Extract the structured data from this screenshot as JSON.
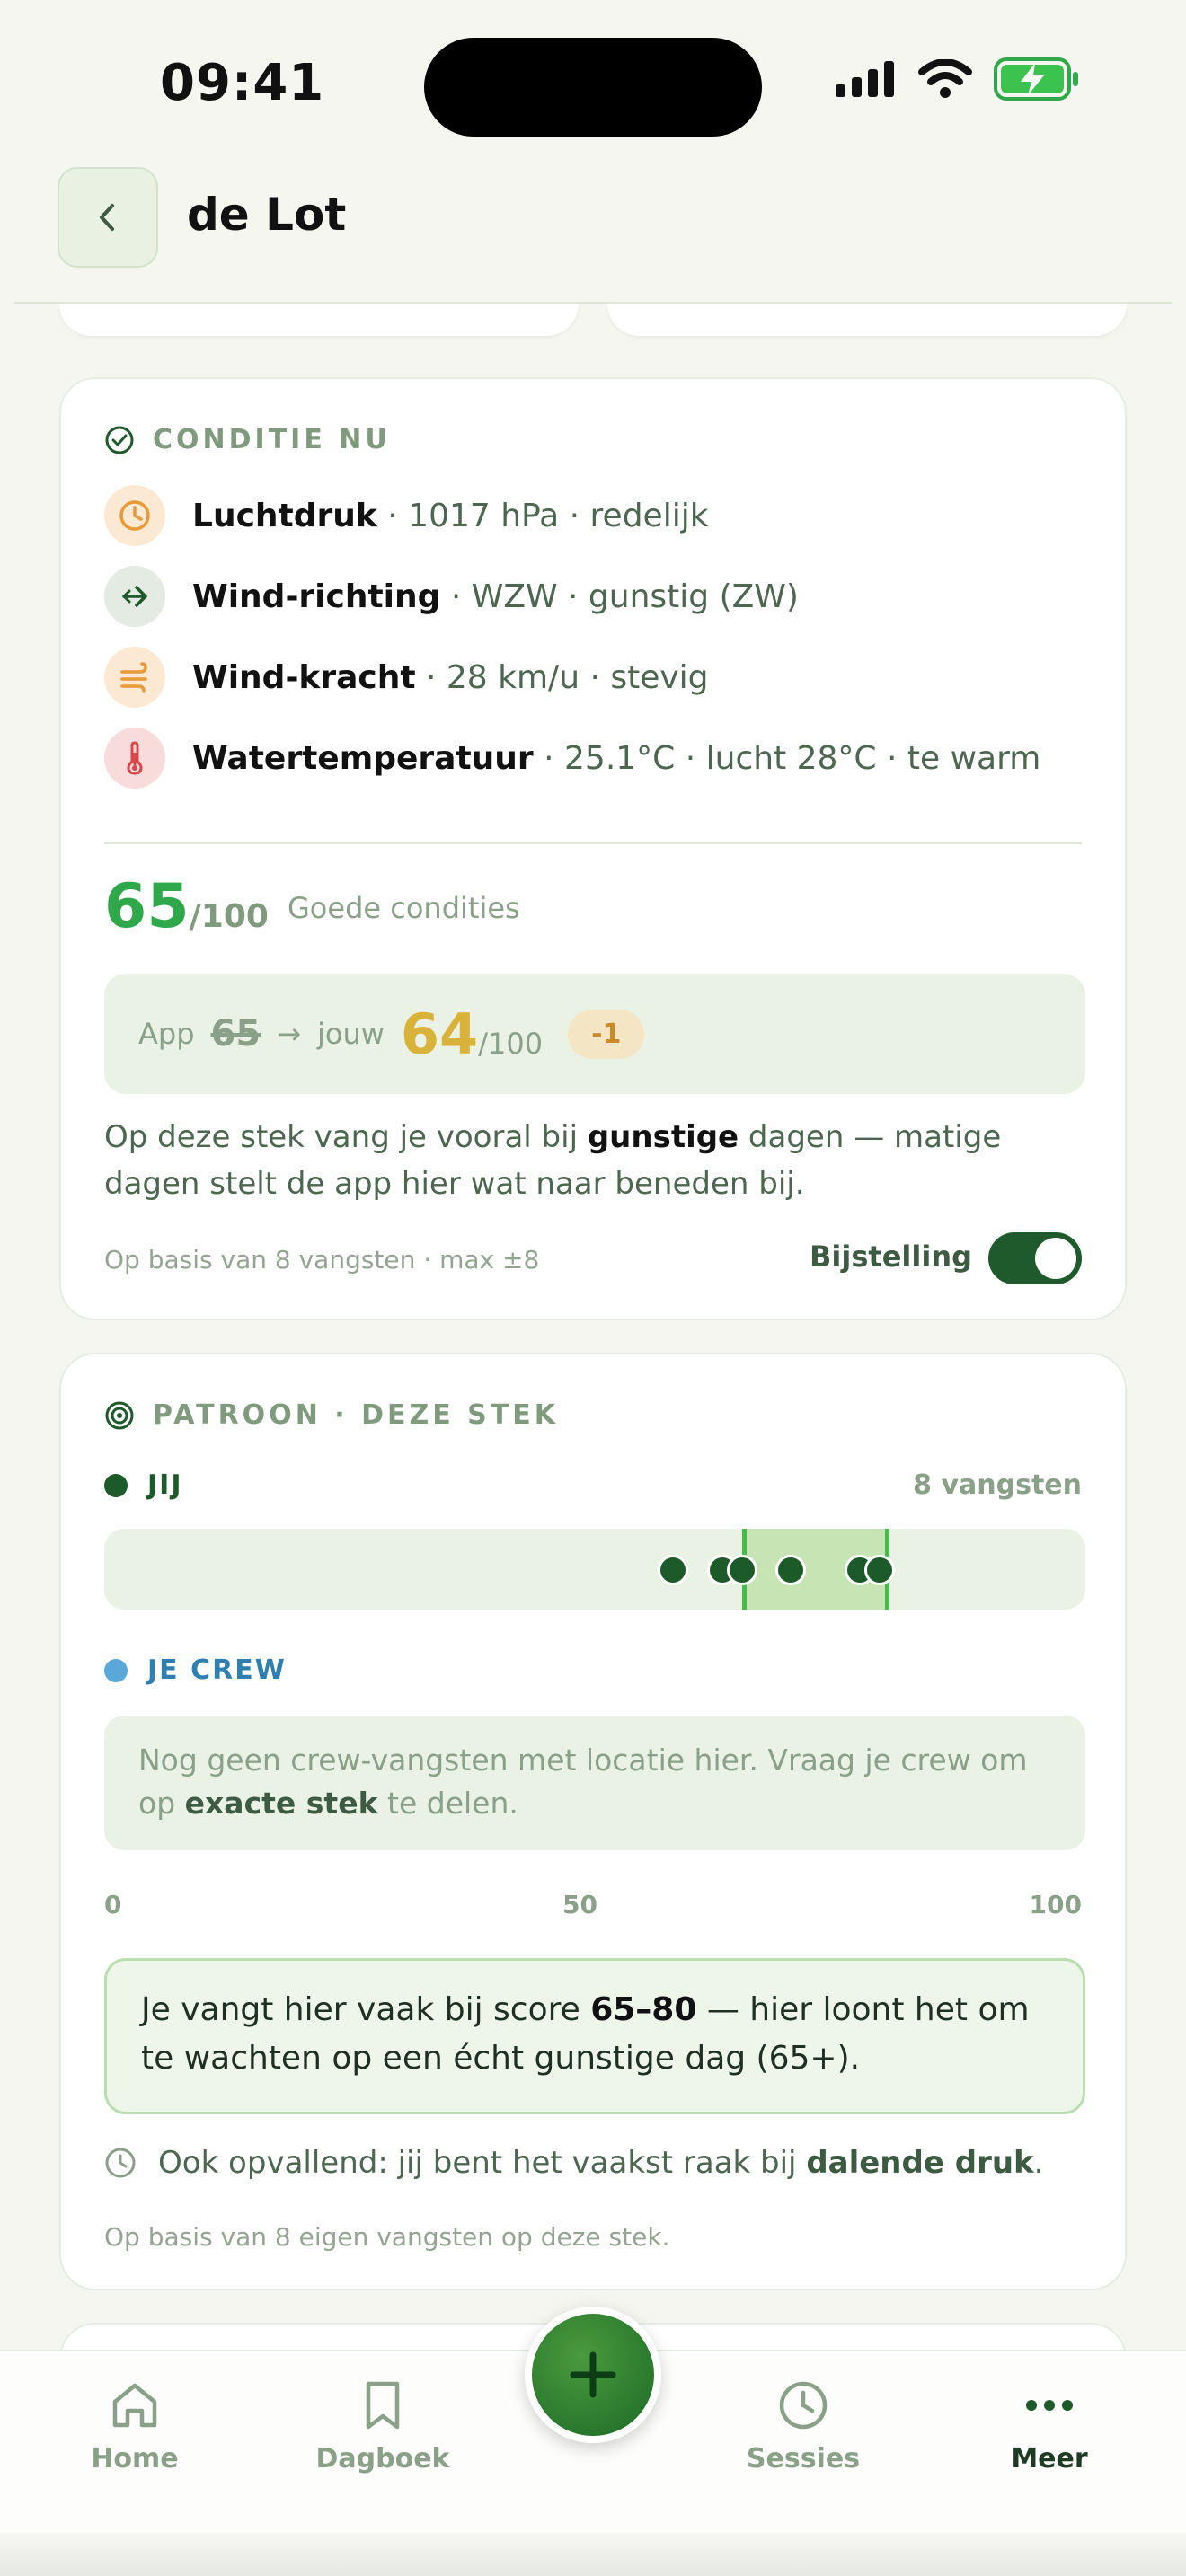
{
  "status": {
    "time": "09:41"
  },
  "header": {
    "title": "de Lot"
  },
  "condition": {
    "section_title": "CONDITIE NU",
    "rows": [
      {
        "icon": "clock-icon",
        "label": "Luchtdruk",
        "detail": " · 1017 hPa · redelijk",
        "color": "#e8993a",
        "bg": "#fbe9d4"
      },
      {
        "icon": "arrow-right-icon",
        "label": "Wind-richting",
        "detail": " · WZW · gunstig (ZW)",
        "color": "#1f5a2c",
        "bg": "#e4ebe2"
      },
      {
        "icon": "wind-icon",
        "label": "Wind-kracht",
        "detail": " · 28 km/u · stevig",
        "color": "#e8993a",
        "bg": "#fbe9d4"
      },
      {
        "icon": "thermometer-icon",
        "label": "Watertemperatuur",
        "detail": " · 25.1°C · lucht 28°C · te warm",
        "color": "#d9474a",
        "bg": "#f8dcdc"
      }
    ],
    "score": "65",
    "score_max": "/100",
    "score_label": "Goede condities",
    "adjust": {
      "app_label": "App",
      "app_score": "65",
      "arrow": "→",
      "you_label": "jouw",
      "you_score": "64",
      "you_max": "/100",
      "delta": "-1"
    },
    "explanation_pre": "Op deze stek vang je vooral bij ",
    "explanation_bold": "gunstige",
    "explanation_post": " dagen — matige dagen stelt de app hier wat naar beneden bij.",
    "footnote": "Op basis van 8 vangsten · max ±8",
    "toggle_label": "Bijstelling",
    "toggle_on": true
  },
  "pattern": {
    "section_title": "PATROON · DEZE STEK",
    "you_label": "JIJ",
    "you_count": "8 vangsten",
    "you_color": "#1c5a2a",
    "catch_scores": [
      58,
      63,
      65,
      70,
      77,
      79
    ],
    "band": [
      65,
      80
    ],
    "crew_label": "JE CREW",
    "crew_color": "#5aa7d9",
    "crew_empty_pre": "Nog geen crew-vangsten met locatie hier. Vraag je crew om op ",
    "crew_empty_bold": "exacte stek",
    "crew_empty_post": " te delen.",
    "axis": [
      "0",
      "50",
      "100"
    ],
    "insight_pre": "Je vangt hier vaak bij score ",
    "insight_bold": "65–80",
    "insight_post": " — hier loont het om te wachten op een écht gunstige dag (65+).",
    "extra_pre": "Ook opvallend: jij bent het vaakst raak bij ",
    "extra_bold": "dalende druk",
    "extra_post": ".",
    "footnote": "Op basis van 8 eigen vangsten op deze stek."
  },
  "tabs": [
    {
      "label": "Home",
      "icon": "home-icon"
    },
    {
      "label": "Dagboek",
      "icon": "bookmark-icon"
    },
    {
      "label": "Sessies",
      "icon": "clock-icon"
    },
    {
      "label": "Meer",
      "icon": "more-icon"
    }
  ]
}
